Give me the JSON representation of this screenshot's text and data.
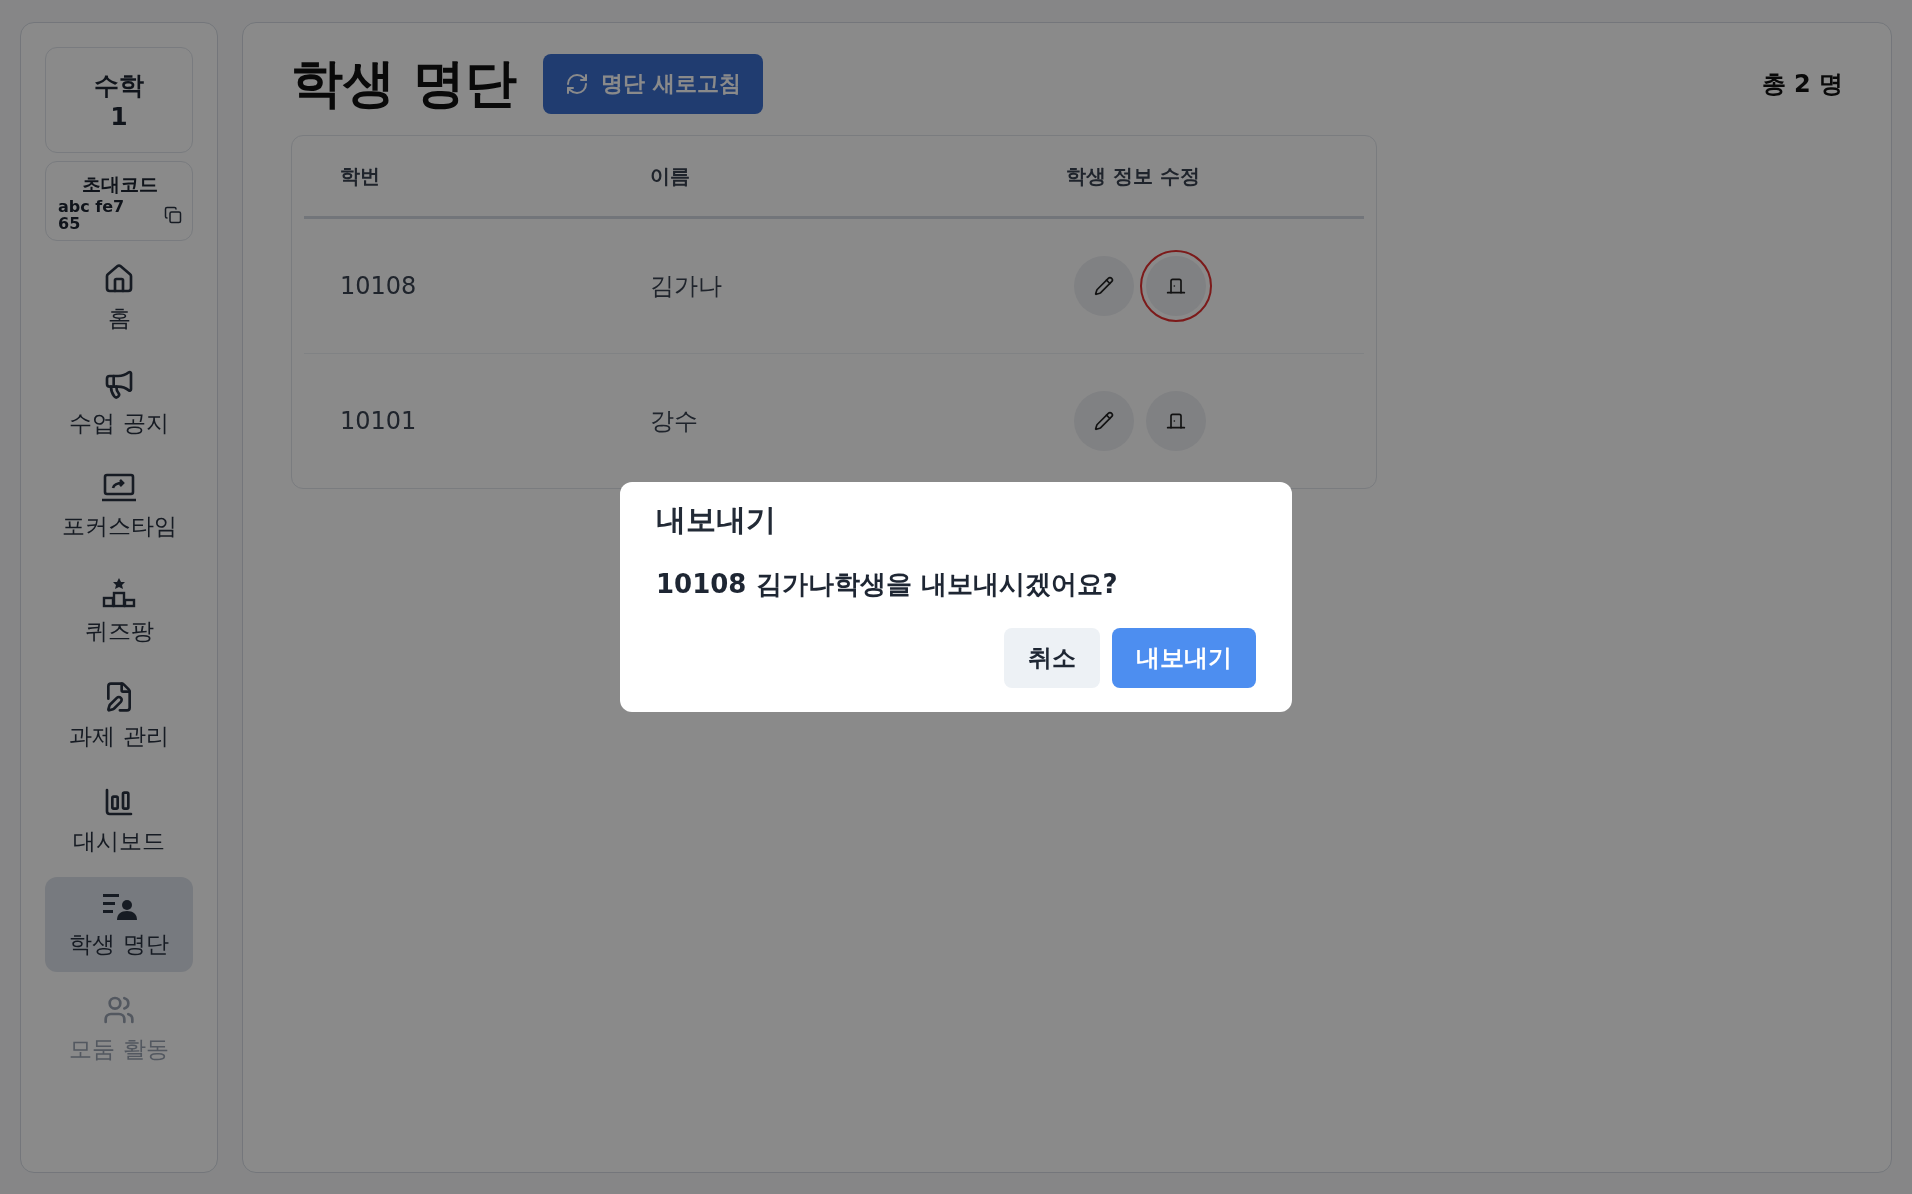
{
  "sidebar": {
    "class_card": {
      "subject": "수학",
      "number": "1"
    },
    "invite_code": {
      "label": "초대코드",
      "code": "abc fe7\n65"
    },
    "items": [
      {
        "label": "홈",
        "selected": false,
        "disabled": false
      },
      {
        "label": "수업 공지",
        "selected": false,
        "disabled": false
      },
      {
        "label": "포커스타임",
        "selected": false,
        "disabled": false
      },
      {
        "label": "퀴즈팡",
        "selected": false,
        "disabled": false
      },
      {
        "label": "과제 관리",
        "selected": false,
        "disabled": false
      },
      {
        "label": "대시보드",
        "selected": false,
        "disabled": false
      },
      {
        "label": "학생 명단",
        "selected": true,
        "disabled": false
      },
      {
        "label": "모둠 활동",
        "selected": false,
        "disabled": true
      }
    ]
  },
  "header": {
    "title": "학생 명단",
    "refresh_button": "명단 새로고침",
    "total": "총 2 명"
  },
  "table": {
    "columns": [
      "학번",
      "이름",
      "학생 정보 수정"
    ],
    "rows": [
      {
        "id": "10108",
        "name": "김가나",
        "exit_highlighted": true
      },
      {
        "id": "10101",
        "name": "강수",
        "exit_highlighted": false
      }
    ]
  },
  "dialog": {
    "title": "내보내기",
    "message": "10108 김가나학생을 내보내시겠어요?",
    "buttons": [
      {
        "kind": "secondary",
        "label": "취소"
      },
      {
        "kind": "primary",
        "label": "내보내기"
      }
    ]
  }
}
